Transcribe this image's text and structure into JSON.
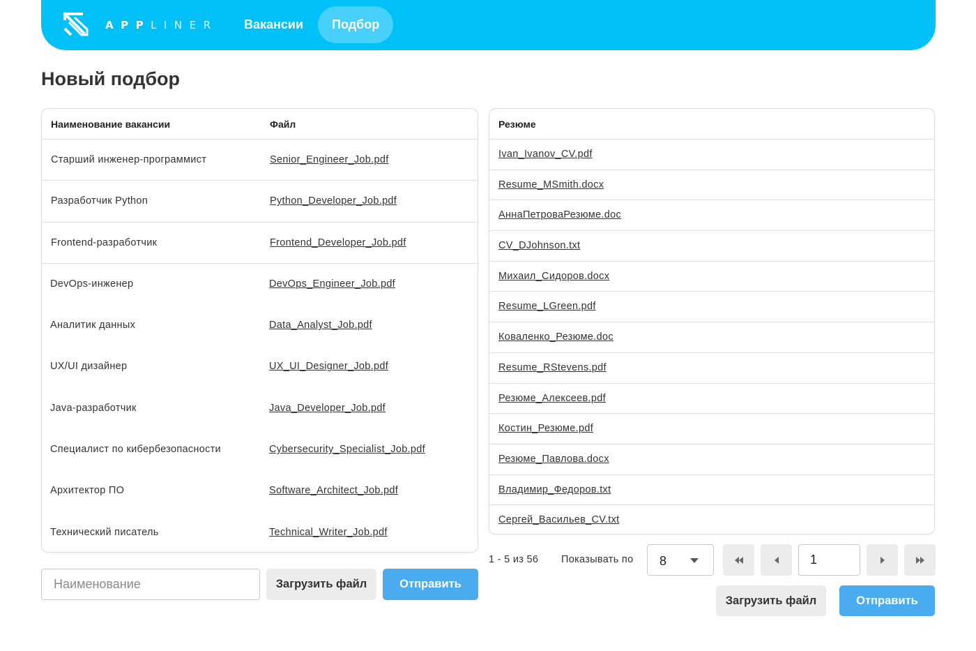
{
  "header": {
    "logo_bold": "APP",
    "logo_light": "LINER",
    "nav": [
      {
        "label": "Вакансии",
        "active": false
      },
      {
        "label": "Подбор",
        "active": true
      }
    ],
    "accent_color": "#00c0f8"
  },
  "page": {
    "title": "Новый подбор"
  },
  "vacancies": {
    "columns": [
      "Наименование вакансии",
      "Файл"
    ],
    "rows": [
      {
        "name": "Старший инженер-программист",
        "file": "Senior_Engineer_Job.pdf"
      },
      {
        "name": "Разработчик Python",
        "file": "Python_Developer_Job.pdf"
      },
      {
        "name": "Frontend-разработчик",
        "file": "Frontend_Developer_Job.pdf"
      },
      {
        "name": "DevOps-инженер",
        "file": "DevOps_Engineer_Job.pdf"
      },
      {
        "name": "Аналитик данных",
        "file": "Data_Analyst_Job.pdf"
      },
      {
        "name": "UX/UI дизайнер",
        "file": "UX_UI_Designer_Job.pdf"
      },
      {
        "name": "Java-разработчик",
        "file": "Java_Developer_Job.pdf"
      },
      {
        "name": "Специалист по кибербезопасности",
        "file": "Cybersecurity_Specialist_Job.pdf"
      },
      {
        "name": "Архитектор ПО",
        "file": "Software_Architect_Job.pdf"
      },
      {
        "name": "Технический писатель",
        "file": "Technical_Writer_Job.pdf"
      }
    ],
    "name_placeholder": "Наименование",
    "upload_label": "Загрузить файл",
    "send_label": "Отправить"
  },
  "resumes": {
    "column": "Резюме",
    "files": [
      "Ivan_Ivanov_CV.pdf",
      "Resume_MSmith.docx",
      "АннаПетроваРезюме.doc",
      "CV_DJohnson.txt",
      "Михаил_Сидоров.docx",
      "Resume_LGreen.pdf",
      "Коваленко_Резюме.doc",
      "Resume_RStevens.pdf",
      "Резюме_Алексеев.pdf",
      "Костин_Резюме.pdf",
      "Резюме_Павлова.docx",
      "Владимир_Федоров.txt",
      "Сергей_Васильев_CV.txt"
    ],
    "pagination": {
      "range": "1 - 5 из 56",
      "per_page_label": "Показывать по",
      "per_page_value": "8",
      "current_page": "1",
      "icons": [
        "first-page-icon",
        "prev-page-icon",
        "next-page-icon",
        "last-page-icon"
      ]
    },
    "upload_label": "Загрузить файл",
    "send_label": "Отправить"
  },
  "colors": {
    "primary_button": "#4aacee",
    "secondary_button": "#ececec"
  }
}
